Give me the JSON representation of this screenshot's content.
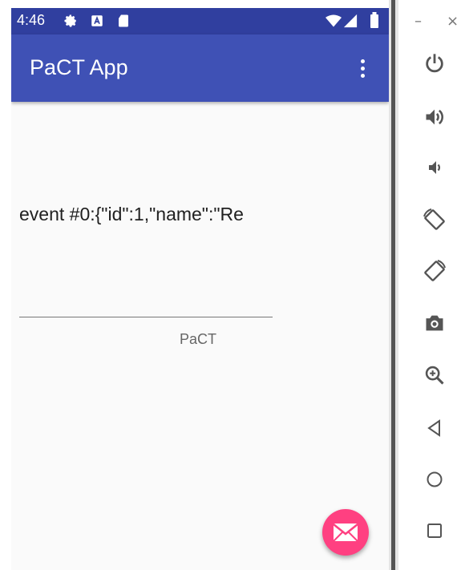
{
  "status_bar": {
    "time": "4:46",
    "icons": [
      "settings-icon",
      "a-notification-icon",
      "sd-card-icon",
      "wifi-icon",
      "signal-icon",
      "battery-icon"
    ]
  },
  "app_bar": {
    "title": "PaCT App",
    "menu_icon": "overflow-menu-icon"
  },
  "main": {
    "event_text": "event #0:{\"id\":1,\"name\":\"Re",
    "field_label": "PaCT"
  },
  "fab": {
    "icon": "mail-icon",
    "color": "#FF4081"
  },
  "emulator_toolbar": {
    "window_buttons": {
      "minimize": "–",
      "close": "×"
    },
    "tools": [
      "power-icon",
      "volume-up-icon",
      "volume-down-icon",
      "rotate-left-icon",
      "rotate-right-icon",
      "camera-icon",
      "zoom-icon",
      "back-icon",
      "home-icon",
      "overview-icon"
    ]
  },
  "colors": {
    "primary_dark": "#303F9F",
    "primary": "#3F51B5",
    "accent": "#FF4081",
    "background": "#FAFAFA"
  }
}
